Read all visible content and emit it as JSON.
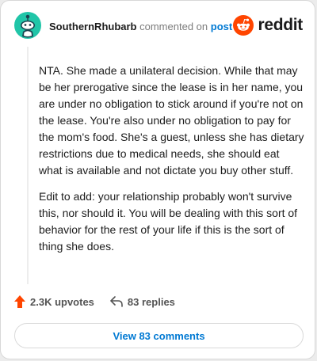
{
  "header": {
    "username": "SouthernRhubarb",
    "verb": "commented on",
    "target": "post"
  },
  "brand": {
    "name": "reddit",
    "logo_icon": "reddit-snoo-icon",
    "logo_color": "#ff4500"
  },
  "avatar": {
    "icon": "snoo-avatar-icon",
    "color": "#20c5a8"
  },
  "comment": {
    "paragraphs": [
      "NTA. She made a unilateral decision. While that may be her prerogative since the lease is in her name, you are under no obligation to stick around if you're not on the lease. You're also under no obligation to pay for the mom's food. She's a guest, unless she has dietary restrictions due to medical needs, she should eat what is available and not dictate you buy other stuff.",
      "Edit to add: your relationship probably won't survive this, nor should it. You will be dealing with this sort of behavior for the rest of your life if this is the sort of thing she does."
    ]
  },
  "actions": {
    "upvotes": "2.3K upvotes",
    "replies": "83 replies",
    "upvote_icon": "upvote-arrow-icon",
    "reply_icon": "reply-arrow-icon",
    "upvote_color": "#ff4500"
  },
  "footer": {
    "view_comments": "View 83 comments"
  }
}
